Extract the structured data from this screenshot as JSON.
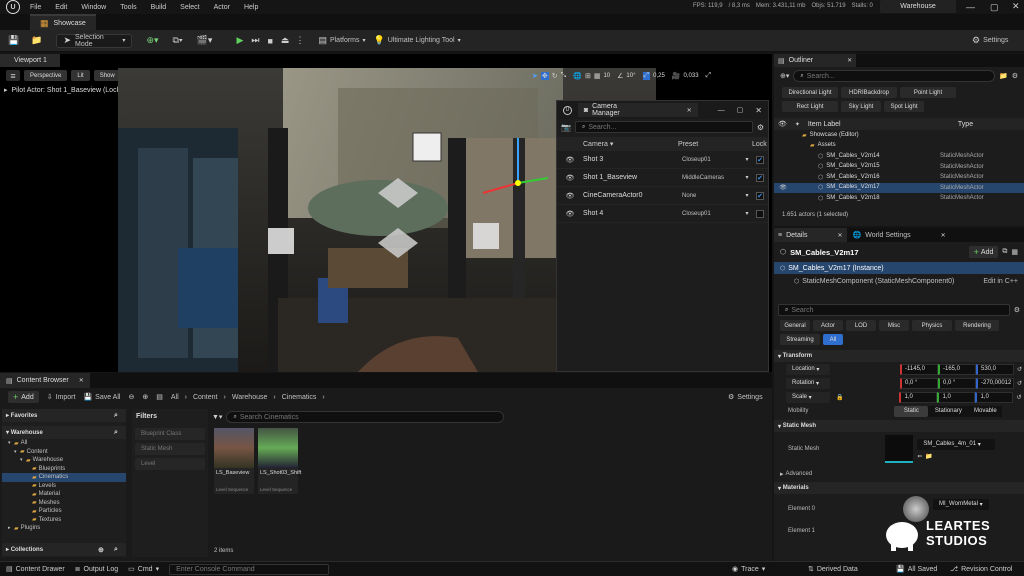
{
  "menu": {
    "items": [
      "File",
      "Edit",
      "Window",
      "Tools",
      "Build",
      "Select",
      "Actor",
      "Help"
    ],
    "fps": "FPS: 119,9",
    "ms": "/ 8,3 ms",
    "mem": "Mem: 3.431,11 mb",
    "objs": "Objs: 51.719",
    "stalls": "Stalls: 0",
    "project": "Warehouse"
  },
  "tabs": {
    "level": "Showcase"
  },
  "toolbar": {
    "mode": "Selection Mode",
    "platforms": "Platforms",
    "lighting": "Ultimate Lighting Tool",
    "settings": "Settings"
  },
  "viewport": {
    "tab": "Viewport 1",
    "perspective": "Perspective",
    "lit": "Lit",
    "show": "Show",
    "pilot": "Pilot Actor: Shot 1_Baseview (Locked)",
    "grid": "10",
    "angle": "10°",
    "scale": "0,25",
    "speed": "0,033"
  },
  "camera_manager": {
    "title": "Camera Manager",
    "search_placeholder": "Search...",
    "col_camera": "Camera",
    "col_preset": "Preset",
    "col_lock": "Lock",
    "rows": [
      {
        "name": "Shot 3",
        "preset": "Closeup01",
        "locked": true
      },
      {
        "name": "Shot 1_Baseview",
        "preset": "MiddleCameras",
        "locked": true
      },
      {
        "name": "CineCameraActor0",
        "preset": "None",
        "locked": true
      },
      {
        "name": "Shot 4",
        "preset": "Closeup01",
        "locked": false
      }
    ]
  },
  "content_browser": {
    "tab": "Content Browser",
    "add": "Add",
    "import": "Import",
    "save_all": "Save All",
    "crumbs": [
      "All",
      "Content",
      "Warehouse",
      "Cinematics"
    ],
    "settings": "Settings",
    "favorites": "Favorites",
    "root": "Warehouse",
    "tree": [
      "All",
      "Content",
      "Warehouse",
      "Blueprints",
      "Cinematics",
      "Levels",
      "Material",
      "Meshes",
      "Particles",
      "Textures",
      "Plugins"
    ],
    "collections": "Collections",
    "filters": "Filters",
    "filter_items": [
      "Blueprint Class",
      "Static Mesh",
      "Level"
    ],
    "search_placeholder": "Search Cinematics",
    "assets": [
      {
        "name": "LS_Baseview",
        "type": "Level Sequence"
      },
      {
        "name": "LS_Shot03_Shift",
        "type": "Level Sequence"
      }
    ],
    "count": "2 items"
  },
  "outliner": {
    "title": "Outliner",
    "search_placeholder": "Search...",
    "filters": [
      "Directional Light",
      "HDRIBackdrop",
      "Point Light",
      "Rect Light",
      "Sky Light",
      "Spot Light"
    ],
    "col_label": "Item Label",
    "col_type": "Type",
    "rows": [
      {
        "label": "Showcase (Editor)",
        "type": ""
      },
      {
        "label": "Assets",
        "type": ""
      },
      {
        "label": "SM_Cables_V2m14",
        "type": "StaticMeshActor"
      },
      {
        "label": "SM_Cables_V2m15",
        "type": "StaticMeshActor"
      },
      {
        "label": "SM_Cables_V2m16",
        "type": "StaticMeshActor"
      },
      {
        "label": "SM_Cables_V2m17",
        "type": "StaticMeshActor"
      },
      {
        "label": "SM_Cables_V2m18",
        "type": "StaticMeshActor"
      }
    ],
    "footer": "1.651 actors (1 selected)"
  },
  "details": {
    "title": "Details",
    "world_settings": "World Settings",
    "actor": "SM_Cables_V2m17",
    "add": "Add",
    "instance": "SM_Cables_V2m17 (Instance)",
    "component": "StaticMeshComponent (StaticMeshComponent0)",
    "edit_cpp": "Edit in C++",
    "search_placeholder": "Search",
    "cats": [
      "General",
      "Actor",
      "LOD",
      "Misc",
      "Physics",
      "Rendering",
      "Streaming",
      "All"
    ],
    "transform": "Transform",
    "location": "Location",
    "rotation": "Rotation",
    "scale": "Scale",
    "loc": [
      "-1145,0",
      "-165,0",
      "530,0"
    ],
    "rot": [
      "0,0 °",
      "0,0 °",
      "-270,00012"
    ],
    "scl": [
      "1,0",
      "1,0",
      "1,0"
    ],
    "mobility": "Mobility",
    "mob_opts": [
      "Static",
      "Stationary",
      "Movable"
    ],
    "static_mesh_hdr": "Static Mesh",
    "static_mesh_lbl": "Static Mesh",
    "mesh_value": "SM_Cables_4m_01",
    "advanced": "Advanced",
    "materials": "Materials",
    "element0": "Element 0",
    "element1": "Element 1",
    "mat_value": "MI_WornMetal",
    "watermark1": "LEARTES",
    "watermark2": "STUDIOS"
  },
  "status": {
    "drawer": "Content Drawer",
    "log": "Output Log",
    "cmd": "Cmd",
    "console_placeholder": "Enter Console Command",
    "trace": "Trace",
    "derived": "Derived Data",
    "saved": "All Saved",
    "revision": "Revision Control"
  }
}
